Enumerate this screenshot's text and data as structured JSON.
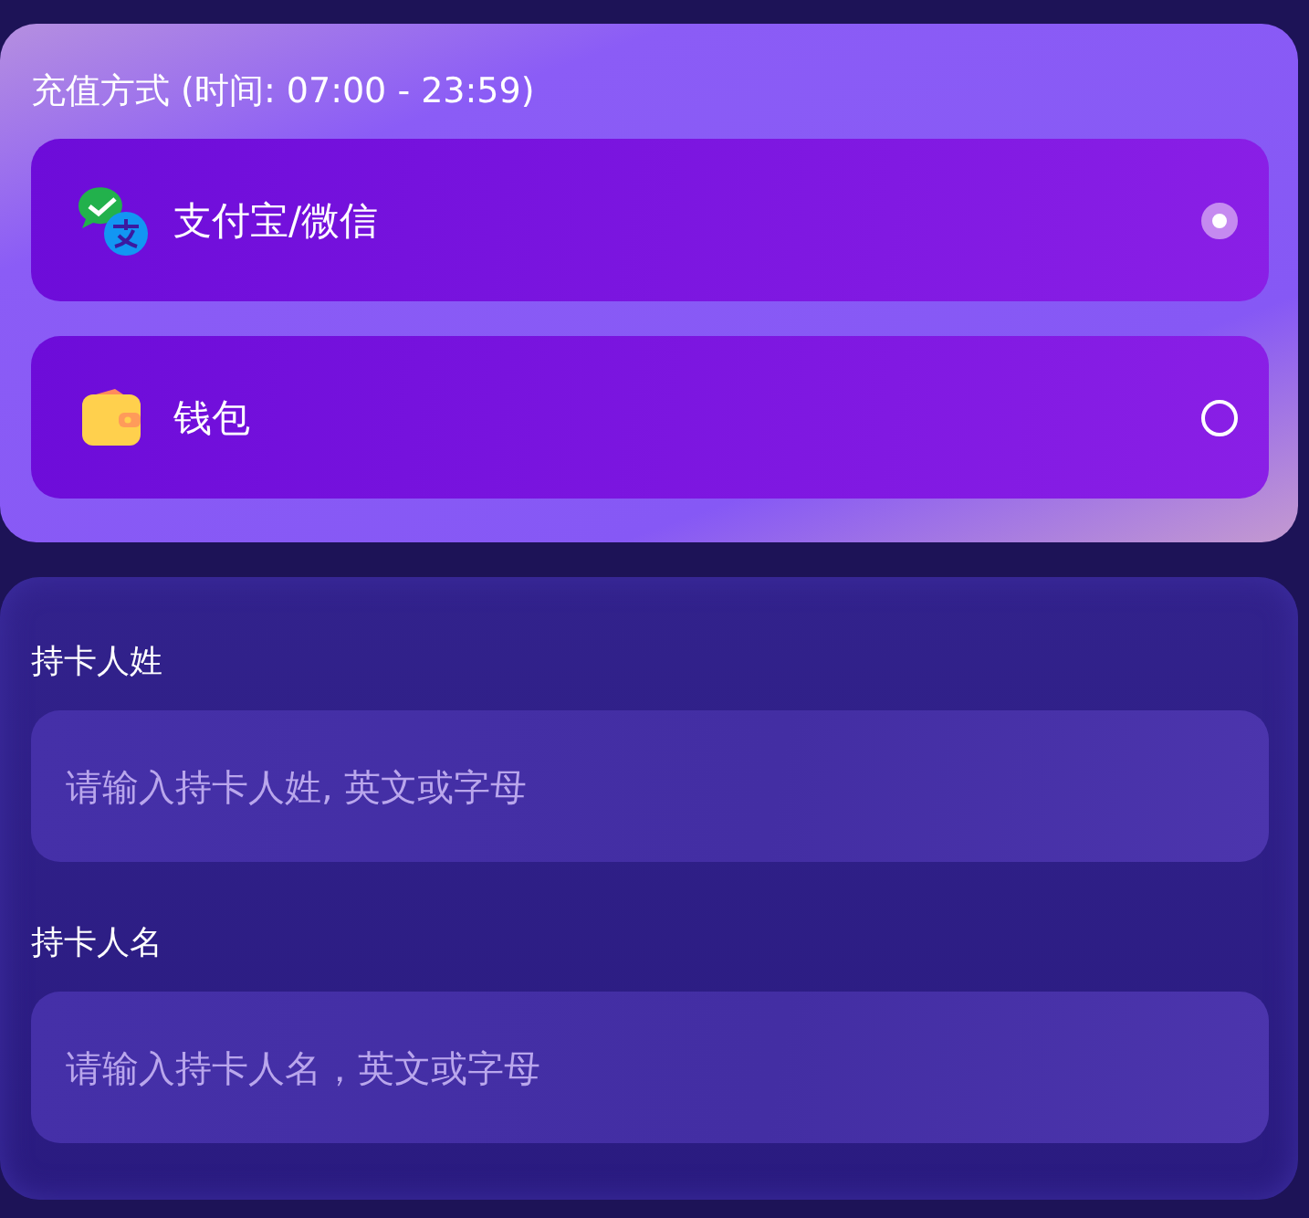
{
  "payment": {
    "title": "充值方式 (时间: 07:00 - 23:59)",
    "options": [
      {
        "kind": "wechat-alipay",
        "label": "支付宝/微信",
        "selected": true
      },
      {
        "kind": "wallet",
        "label": "钱包",
        "selected": false
      }
    ]
  },
  "form": {
    "fields": [
      {
        "label": "持卡人姓",
        "placeholder": "请输入持卡人姓, 英文或字母"
      },
      {
        "label": "持卡人名",
        "placeholder": "请输入持卡人名，英文或字母"
      }
    ]
  }
}
